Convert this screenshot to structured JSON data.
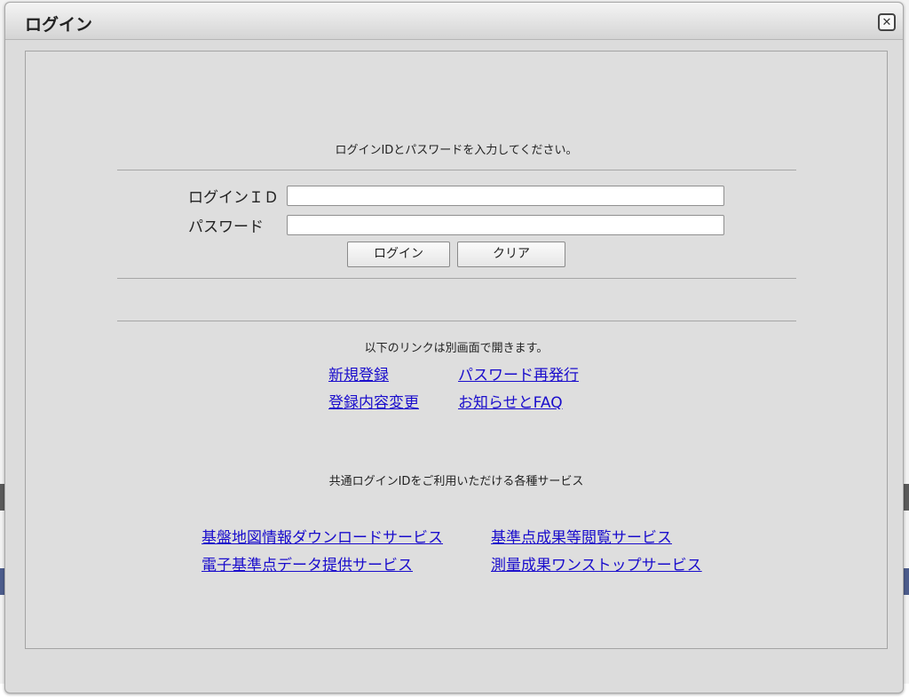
{
  "dialog": {
    "title": "ログイン",
    "close_icon": "close-icon"
  },
  "form": {
    "instruction": "ログインIDとパスワードを入力してください。",
    "id_label": "ログインＩＤ",
    "password_label": "パスワード",
    "id_value": "",
    "password_value": "",
    "login_button": "ログイン",
    "clear_button": "クリア"
  },
  "links": {
    "note": "以下のリンクは別画面で開きます。",
    "register": "新規登録",
    "reissue_password": "パスワード再発行",
    "change_registration": "登録内容変更",
    "news_faq": "お知らせとFAQ"
  },
  "services": {
    "title": "共通ログインIDをご利用いただける各種サービス",
    "items": [
      "基盤地図情報ダウンロードサービス",
      "基準点成果等閲覧サービス",
      "電子基準点データ提供サービス",
      "測量成果ワンストップサービス"
    ]
  },
  "colors": {
    "link": "#1a0dcc",
    "panel": "#dedede",
    "titlebar": "#e4e4e4"
  }
}
